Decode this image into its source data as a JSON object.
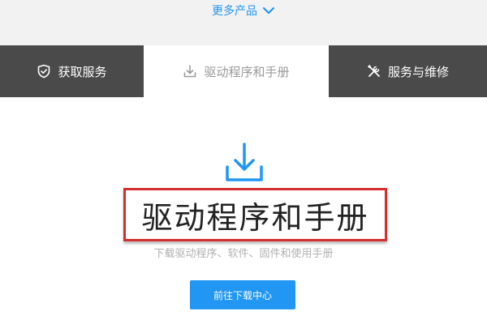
{
  "header": {
    "more_products_label": "更多产品",
    "more_products_icon": "chevron-down-icon"
  },
  "tabs": [
    {
      "label": "获取服务",
      "icon": "shield-check-icon",
      "active": false
    },
    {
      "label": "驱动程序和手册",
      "icon": "download-icon",
      "active": true
    },
    {
      "label": "服务与维修",
      "icon": "tools-icon",
      "active": false
    }
  ],
  "main": {
    "icon": "download-icon",
    "title": "驱动程序和手册",
    "subtitle": "下载驱动程序、软件、固件和使用手册",
    "cta_label": "前往下载中心"
  },
  "colors": {
    "accent": "#2196f3",
    "tab_dark": "#4a4a4a",
    "highlight_border": "#d32f2f"
  }
}
